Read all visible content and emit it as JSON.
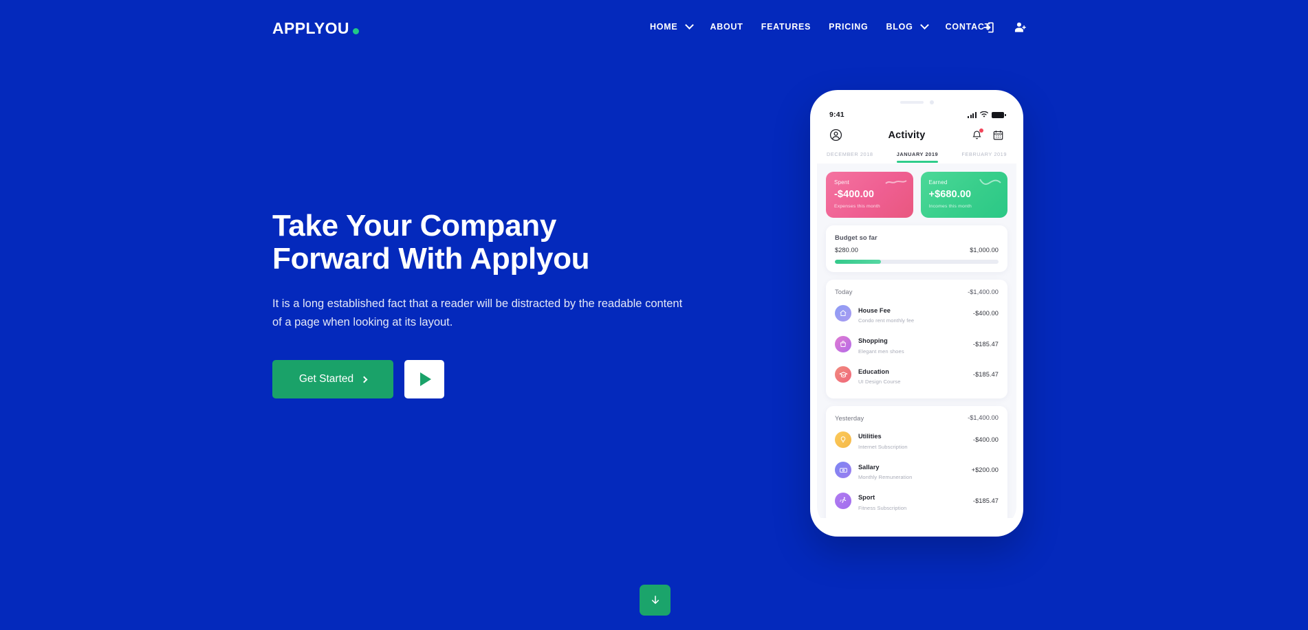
{
  "theme": {
    "background_blue": "#0429BC",
    "accent_green": "#1AA269",
    "logo_dot_green": "#21C986"
  },
  "navbar": {
    "logo_text": "APPLYOU",
    "links": [
      {
        "label": "HOME",
        "has_dropdown": true
      },
      {
        "label": "ABOUT",
        "has_dropdown": false
      },
      {
        "label": "FEATURES",
        "has_dropdown": false
      },
      {
        "label": "PRICING",
        "has_dropdown": false
      },
      {
        "label": "BLOG",
        "has_dropdown": true
      },
      {
        "label": "CONTACT",
        "has_dropdown": false
      }
    ],
    "icons": [
      {
        "name": "sign-in-icon"
      },
      {
        "name": "register-user-icon"
      }
    ]
  },
  "hero": {
    "title_line1": "Take Your Company",
    "title_line2": "Forward With Applyou",
    "subtitle": "It is a long established fact that a reader will be distracted by the readable content of a page when looking at its layout.",
    "primary_button": "Get Started",
    "play_button_icon": "play-icon"
  },
  "scroll_down": {
    "icon": "arrow-down-icon"
  },
  "phone": {
    "status": {
      "time": "9:41"
    },
    "app_header": {
      "title": "Activity",
      "profile_icon": "user-circle-icon",
      "bell_icon": "bell-icon",
      "calendar_icon": "calendar-icon"
    },
    "months": [
      {
        "label": "DECEMBER 2018",
        "active": false
      },
      {
        "label": "JANUARY 2019",
        "active": true
      },
      {
        "label": "FEBRUARY 2019",
        "active": false
      }
    ],
    "summary": [
      {
        "label": "Spent",
        "amount": "-$400.00",
        "note": "Expenses this month",
        "color": "#EF5F92"
      },
      {
        "label": "Earned",
        "amount": "+$680.00",
        "note": "Incomes this month",
        "color": "#38CE8B"
      }
    ],
    "budget": {
      "title": "Budget so far",
      "spent": "$280.00",
      "total": "$1,000.00",
      "progress_percent": 28
    },
    "sections": [
      {
        "name": "Today",
        "total": "-$1,400.00",
        "transactions": [
          {
            "name": "House Fee",
            "desc": "Condo rent monthly fee",
            "amount": "-$400.00",
            "icon": "house-icon",
            "color_start": "#8C9CF5",
            "color_end": "#A99BF0"
          },
          {
            "name": "Shopping",
            "desc": "Elegant men shoes",
            "amount": "-$185.47",
            "icon": "shopping-bag-icon",
            "color_start": "#E07BD0",
            "color_end": "#B46BE8"
          },
          {
            "name": "Education",
            "desc": "UI Design Course",
            "amount": "-$185.47",
            "icon": "graduation-cap-icon",
            "color_start": "#F08A7E",
            "color_end": "#F0677A"
          }
        ]
      },
      {
        "name": "Yesterday",
        "total": "-$1,400.00",
        "transactions": [
          {
            "name": "Utilities",
            "desc": "Internet Subscription",
            "amount": "-$400.00",
            "icon": "lightbulb-icon",
            "color_start": "#FBC95A",
            "color_end": "#F5B949"
          },
          {
            "name": "Sallary",
            "desc": "Monthly Remuneration",
            "amount": "+$200.00",
            "icon": "money-icon",
            "color_start": "#7C86F2",
            "color_end": "#9B7DF0"
          },
          {
            "name": "Sport",
            "desc": "Fitness Subscription",
            "amount": "-$185.47",
            "icon": "runner-icon",
            "color_start": "#B07BF0",
            "color_end": "#A26EEE"
          }
        ]
      }
    ]
  }
}
